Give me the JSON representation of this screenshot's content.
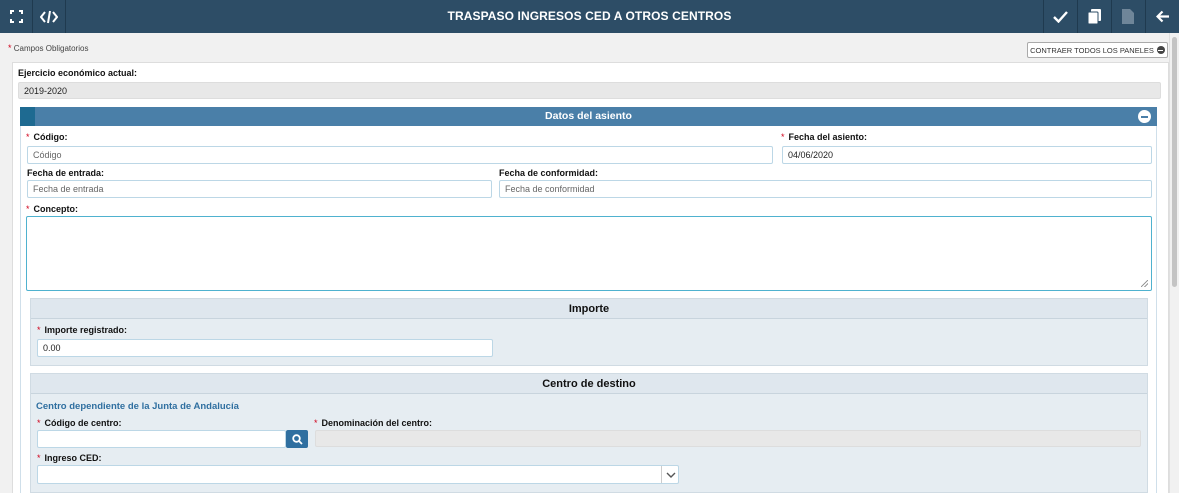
{
  "header": {
    "title": "TRASPASO INGRESOS CED A OTROS CENTROS",
    "accent_color": "#2d4d66"
  },
  "toolbar": {
    "left_icons": [
      "fullscreen-icon",
      "code-icon"
    ],
    "right_icons": [
      "check-icon",
      "copy-icon",
      "document-disabled-icon",
      "back-arrow-icon"
    ]
  },
  "required_note": {
    "marker": "*",
    "label": "Campos Obligatorios"
  },
  "collapse_all_label": "CONTRAER TODOS LOS PANELES",
  "ejercicio": {
    "label": "Ejercicio económico actual:",
    "value": "2019-2020"
  },
  "datos_asiento": {
    "title": "Datos del asiento",
    "codigo": {
      "label": "Código:",
      "placeholder": "Código"
    },
    "fecha_asiento": {
      "label": "Fecha del asiento:",
      "value": "04/06/2020"
    },
    "fecha_entrada": {
      "label": "Fecha de entrada:",
      "placeholder": "Fecha de entrada"
    },
    "fecha_conformidad": {
      "label": "Fecha de conformidad:",
      "placeholder": "Fecha de conformidad"
    },
    "concepto": {
      "label": "Concepto:",
      "value": ""
    }
  },
  "importe": {
    "title": "Importe",
    "importe_registrado": {
      "label": "Importe registrado:",
      "value": "0.00"
    }
  },
  "centro_destino": {
    "title": "Centro de destino",
    "subtitle": "Centro dependiente de la Junta de Andalucía",
    "codigo_centro": {
      "label": "Código de centro:",
      "value": ""
    },
    "denominacion": {
      "label": "Denominación del centro:",
      "value": ""
    },
    "ingreso_ced": {
      "label": "Ingreso CED:",
      "value": ""
    }
  }
}
